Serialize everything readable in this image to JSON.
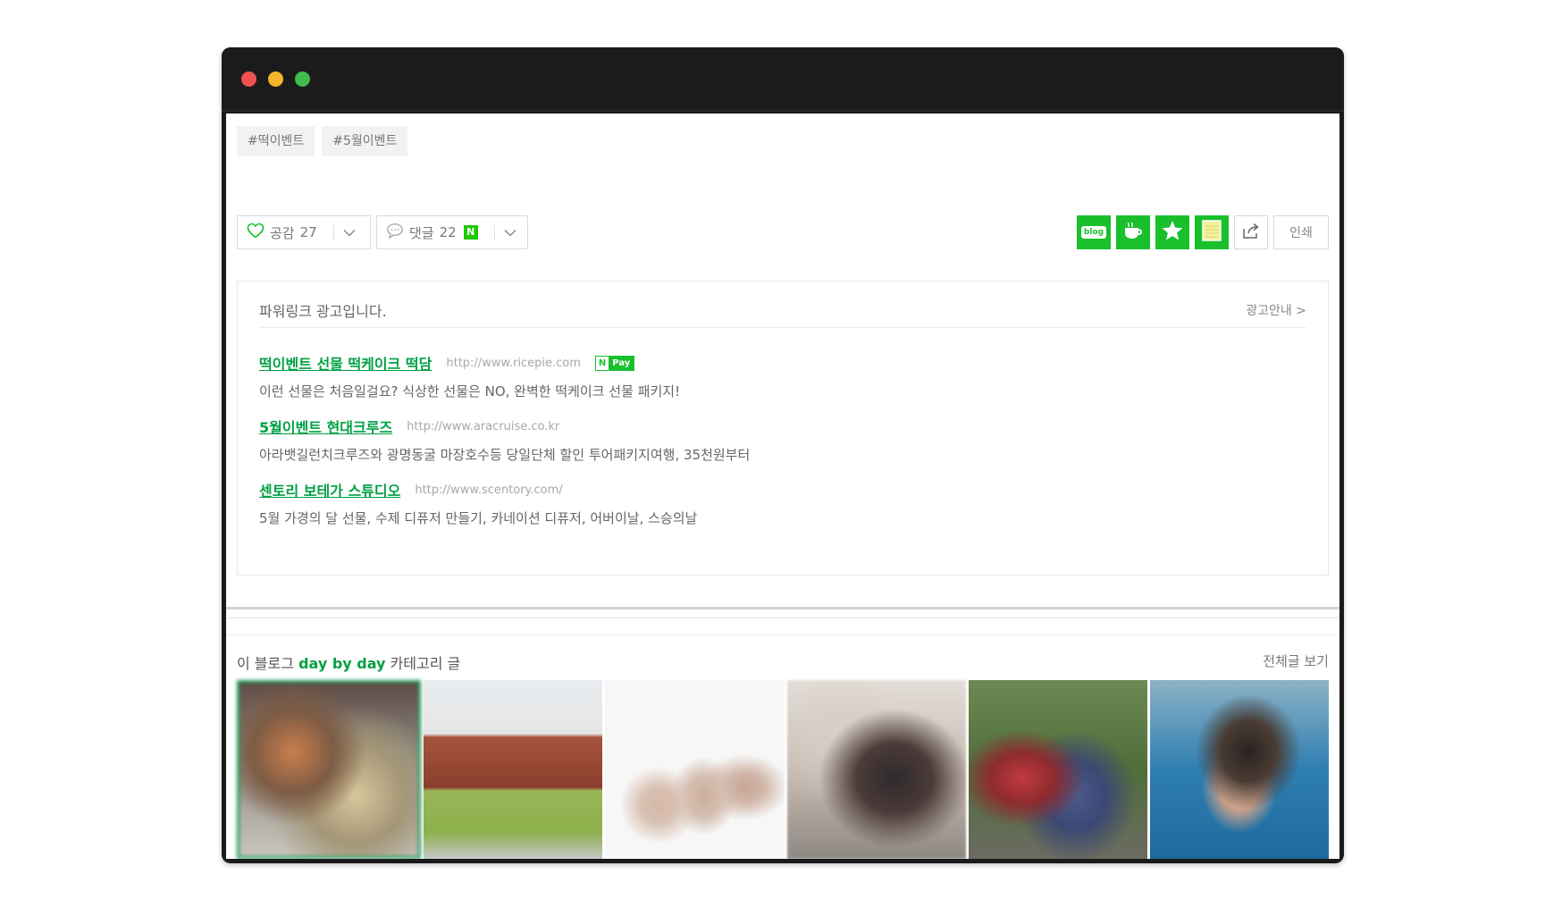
{
  "tags": [
    "#떡이벤트",
    "#5월이벤트"
  ],
  "actions": {
    "like_label": "공감",
    "like_count": "27",
    "comment_label": "댓글",
    "comment_count": "22",
    "comment_badge": "N",
    "print_label": "인쇄",
    "blog_icon_text": "blog"
  },
  "ads": {
    "header": "파워링크 광고입니다.",
    "guide": "광고안내 >",
    "npay_n": "N",
    "npay_text": "Pay",
    "items": [
      {
        "title": "떡이벤트 선물 떡케이크 떡담",
        "url": "http://www.ricepie.com",
        "desc": "이런 선물은 처음일걸요? 식상한 선물은 NO, 완벽한 떡케이크 선물 패키지!"
      },
      {
        "title": "5월이벤트 현대크루즈",
        "url": "http://www.aracruise.co.kr",
        "desc": "아라뱃길런치크루즈와 광명동굴 마장호수등 당일단체 할인 투어패키지여행, 35천원부터"
      },
      {
        "title": "센토리 보테가 스튜디오",
        "url": "http://www.scentory.com/",
        "desc": "5월 가경의 달 선물, 수제 디퓨저 만들기, 카네이션 디퓨저, 어버이날, 스승의날"
      }
    ]
  },
  "category": {
    "prefix": "이 블로그",
    "name": "day by day",
    "suffix": "카테고리 글",
    "view_all": "전체글 보기"
  },
  "colors": {
    "brand_green": "#19c02c",
    "link_green": "#00a043",
    "titlebar": "#1b1b1b"
  },
  "icons": [
    "heart-icon",
    "chevron-down-icon",
    "speech-bubble-icon",
    "blog-icon",
    "cafe-icon",
    "star-icon",
    "memo-icon",
    "share-icon"
  ]
}
